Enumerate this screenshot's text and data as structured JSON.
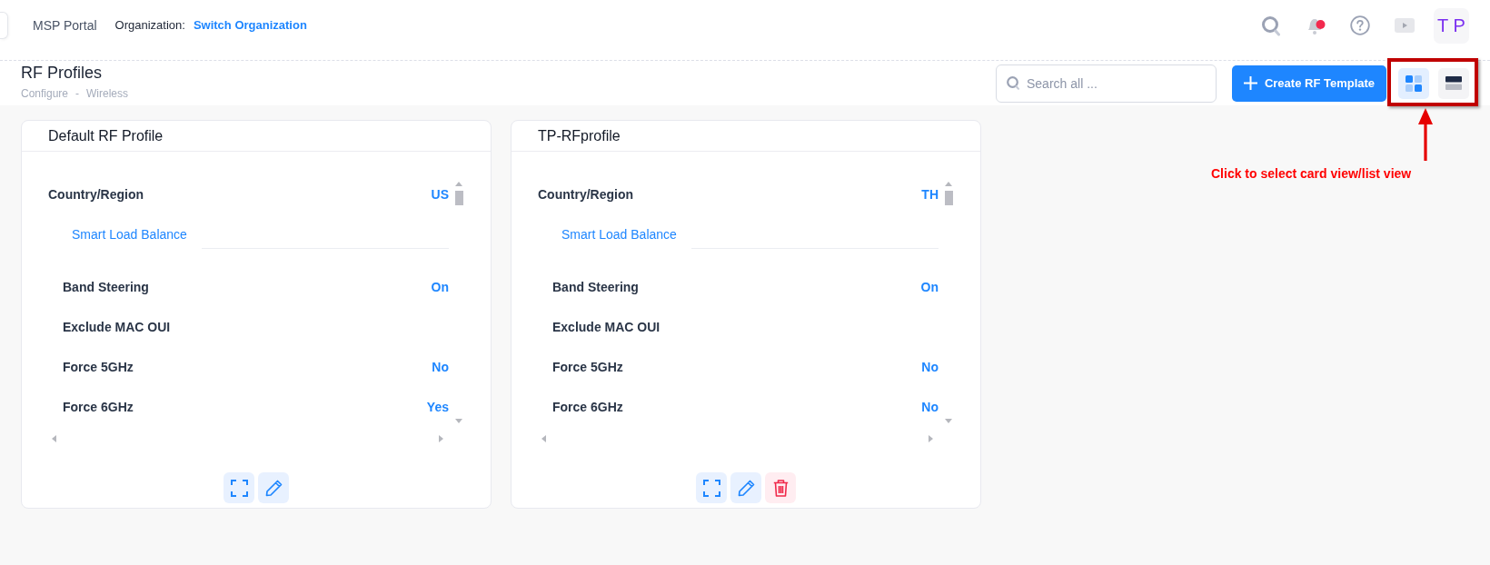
{
  "header": {
    "portal_name": "MSP Portal",
    "organization_label": "Organization:",
    "organization_link": "Switch Organization",
    "avatar": "T P"
  },
  "page": {
    "title": "RF Profiles",
    "breadcrumb": [
      "Configure",
      "Wireless"
    ],
    "breadcrumb_separator": "-",
    "search": {
      "placeholder": "Search all ..."
    },
    "create_button": {
      "label": "Create RF Template"
    },
    "view_toggle": [
      {
        "kind": "card",
        "selected": true
      },
      {
        "kind": "list",
        "selected": false
      }
    ]
  },
  "profiles": [
    {
      "name": "Default RF Profile",
      "country": {
        "label": "Country/Region",
        "value": "US"
      },
      "section": "Smart Load Balance",
      "settings": [
        {
          "label": "Band Steering",
          "value": "On"
        },
        {
          "label": "Exclude MAC OUI"
        },
        {
          "label": "Force 5GHz",
          "value": "No"
        },
        {
          "label": "Force 6GHz",
          "value": "Yes"
        }
      ],
      "actions": [
        {
          "kind": "expand"
        },
        {
          "kind": "edit"
        }
      ]
    },
    {
      "name": "TP-RFprofile",
      "country": {
        "label": "Country/Region",
        "value": "TH"
      },
      "section": "Smart Load Balance",
      "settings": [
        {
          "label": "Band Steering",
          "value": "On"
        },
        {
          "label": "Exclude MAC OUI"
        },
        {
          "label": "Force 5GHz",
          "value": "No"
        },
        {
          "label": "Force 6GHz",
          "value": "No"
        }
      ],
      "actions": [
        {
          "kind": "expand"
        },
        {
          "kind": "edit"
        },
        {
          "kind": "delete"
        }
      ]
    }
  ],
  "annotation": {
    "text": "Click to select card view/list view"
  }
}
